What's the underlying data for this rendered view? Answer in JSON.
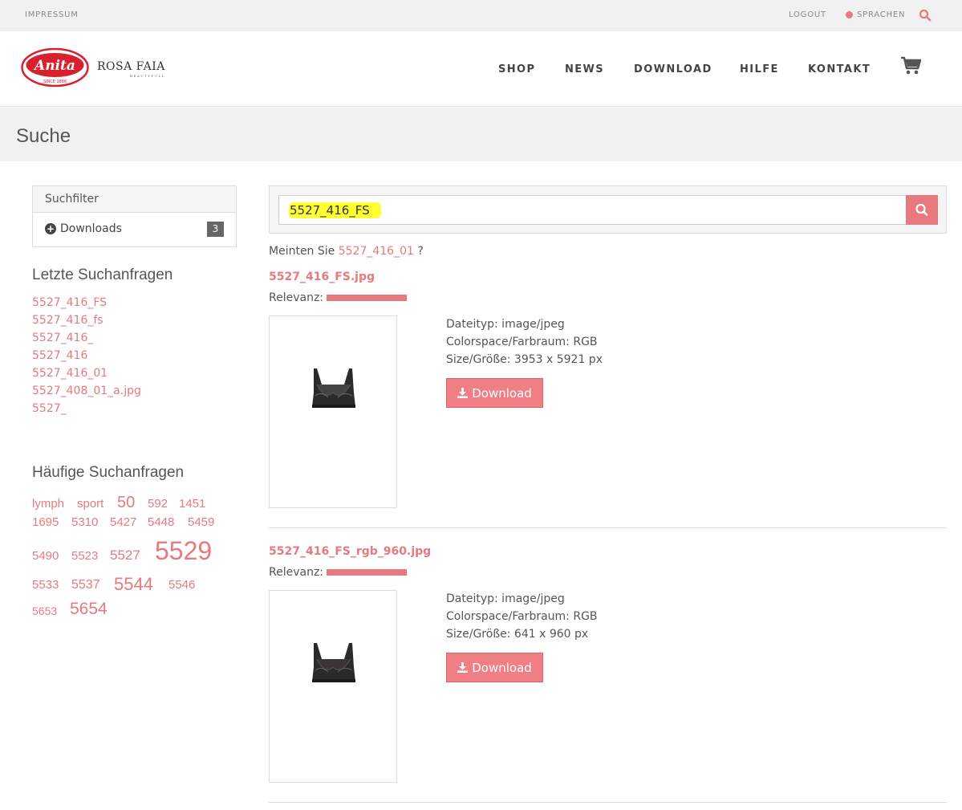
{
  "topbar": {
    "impressum": "IMPRESSUM",
    "logout": "LOGOUT",
    "languages": "SPRACHEN"
  },
  "header": {
    "brand_primary": "Anita",
    "brand_since": "SINCE 1886",
    "brand_secondary": "ROSA FAIA",
    "brand_secondary_tagline": "BEAUTYFULL",
    "nav": [
      "SHOP",
      "NEWS",
      "DOWNLOAD",
      "HILFE",
      "KONTAKT"
    ]
  },
  "page_title": "Suche",
  "filter": {
    "heading": "Suchfilter",
    "items": [
      {
        "label": "Downloads",
        "count": "3"
      }
    ]
  },
  "recent_searches": {
    "heading": "Letzte Suchanfragen",
    "items": [
      "5527_416_FS",
      "5527_416_fs",
      "5527_416_",
      "5527_416",
      "5527_416_01",
      "5527_408_01_a.jpg",
      "5527_"
    ]
  },
  "frequent_searches": {
    "heading": "Häufige Suchanfragen",
    "tags": [
      "lymph",
      "sport",
      "50",
      "592",
      "1451",
      "1695",
      "5310",
      "5427",
      "5448",
      "5459",
      "5490",
      "5523",
      "5527",
      "5529",
      "5533",
      "5537",
      "5544",
      "5546",
      "5653",
      "5654"
    ]
  },
  "search": {
    "value": "5527_416_FS",
    "did_you_mean_prefix": "Meinten Sie",
    "did_you_mean_term": "5527_416_01",
    "did_you_mean_suffix": "?"
  },
  "results": [
    {
      "title": "5527_416_FS.jpg",
      "relevance_label": "Relevanz:",
      "relevance": 1.0,
      "filetype": "Dateityp: image/jpeg",
      "colorspace": "Colorspace/Farbraum: RGB",
      "size": "Size/Größe: 3953 x 5921 px",
      "download_label": "Download"
    },
    {
      "title": "5527_416_FS_rgb_960.jpg",
      "relevance_label": "Relevanz:",
      "relevance": 1.0,
      "filetype": "Dateityp: image/jpeg",
      "colorspace": "Colorspace/Farbraum: RGB",
      "size": "Size/Größe: 641 x 960 px",
      "download_label": "Download"
    }
  ],
  "colors": {
    "accent": "#e8797f",
    "button": "#f07f85",
    "highlight": "#ffff33",
    "panel_bg": "#f1f1f1"
  }
}
